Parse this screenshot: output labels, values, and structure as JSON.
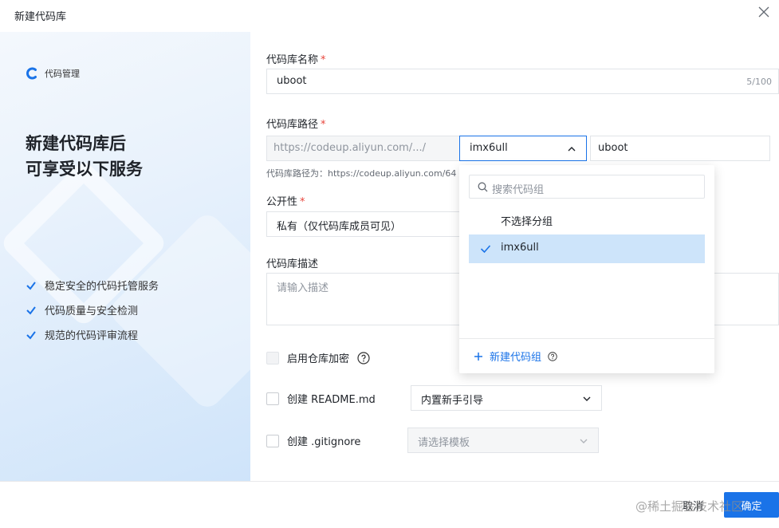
{
  "dialog": {
    "title": "新建代码库"
  },
  "banner": {
    "product": "代码管理",
    "headline_line1": "新建代码库后",
    "headline_line2": "可享受以下服务",
    "features": [
      "稳定安全的代码托管服务",
      "代码质量与安全检测",
      "规范的代码评审流程"
    ]
  },
  "form": {
    "name": {
      "label": "代码库名称",
      "required": "*",
      "value": "uboot",
      "counter": "5/100"
    },
    "path": {
      "label": "代码库路径",
      "required": "*",
      "prefix": "https://codeup.aliyun.com/.../",
      "group": "imx6ull",
      "value": "uboot",
      "hint": "代码库路径为：https://codeup.aliyun.com/64"
    },
    "visibility": {
      "label": "公开性",
      "required": "*",
      "value": "私有（仅代码库成员可见）"
    },
    "description": {
      "label": "代码库描述",
      "placeholder": "请输入描述"
    },
    "encrypt": {
      "label": "启用仓库加密",
      "checked": false,
      "disabled": true
    },
    "readme": {
      "label": "创建 README.md",
      "checked": false,
      "select": "内置新手引导"
    },
    "gitignore": {
      "label": "创建 .gitignore",
      "checked": false,
      "select_placeholder": "请选择模板"
    }
  },
  "dropdown": {
    "search_placeholder": "搜索代码组",
    "options": [
      {
        "label": "不选择分组",
        "selected": false
      },
      {
        "label": "imx6ull",
        "selected": true
      }
    ],
    "new_group": "新建代码组"
  },
  "footer": {
    "cancel": "取消",
    "ok": "确定",
    "watermark": "@稀土掘金技术社区"
  },
  "colors": {
    "primary": "#1a73e8",
    "selected_bg": "#cde4fa",
    "required": "#e8453c"
  }
}
